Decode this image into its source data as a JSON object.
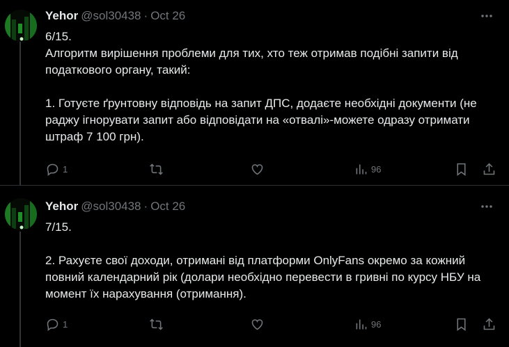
{
  "tweets": [
    {
      "name": "Yehor",
      "handle": "@sol30438",
      "dot": "·",
      "date": "Oct 26",
      "lines": [
        "6/15.",
        "Алгоритм вирішення проблеми для тих, хто теж отримав подібні запити від податкового органу, такий:",
        "",
        "1. Готуєте ґрунтовну відповідь на запит ДПС, додаєте необхідні документи (не раджу ігнорувати запит або відповідати на «отвалі»-можете одразу отримати штраф 7 100 грн)."
      ],
      "replies": "1",
      "views": "96"
    },
    {
      "name": "Yehor",
      "handle": "@sol30438",
      "dot": "·",
      "date": "Oct 26",
      "lines": [
        "7/15.",
        "",
        "2. Рахуєте свої доходи, отримані від платформи OnlyFans окремо за кожний повний календарний рік (долари необхідно перевести в гривні по курсу НБУ на момент їх нарахування (отримання)."
      ],
      "replies": "1",
      "views": "96"
    }
  ],
  "icons": {
    "reply": "reply-icon",
    "retweet": "retweet-icon",
    "like": "like-icon",
    "views": "views-icon",
    "bookmark": "bookmark-icon",
    "share": "share-icon",
    "more": "more-icon"
  },
  "colors": {
    "background": "#000000",
    "text": "#e7e9ea",
    "muted": "#71767b",
    "divider": "#2f3336"
  }
}
